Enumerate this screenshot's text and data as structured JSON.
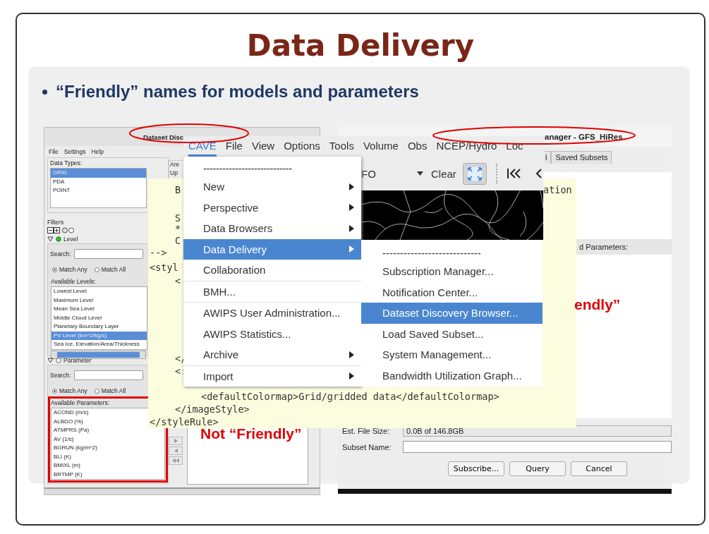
{
  "slide": {
    "title": "Data Delivery",
    "bullet": "“Friendly” names for models and parameters"
  },
  "discovery_window": {
    "title": "Dataset Disc",
    "menu": [
      "File",
      "Settings",
      "Help"
    ],
    "data_types_label": "Data Types:",
    "data_types": [
      {
        "label": "GRID",
        "selected": true
      },
      {
        "label": "PDA",
        "selected": false
      },
      {
        "label": "POINT",
        "selected": false
      }
    ],
    "area_label": "Are",
    "update_label": "Up",
    "filters_label": "Filters",
    "filters": [
      {
        "label": "Level",
        "expanded": true,
        "active": true,
        "search_label": "Search:",
        "match_options": [
          {
            "label": "Match Any",
            "selected": true
          },
          {
            "label": "Match All",
            "selected": false
          }
        ],
        "list_label": "Available Levels:",
        "highlighted": false,
        "items": [
          {
            "label": "Lowest Level",
            "selected": false
          },
          {
            "label": "Maximum Level",
            "selected": false
          },
          {
            "label": "Mean Sea Level",
            "selected": false
          },
          {
            "label": "Middle Cloud Level",
            "selected": false
          },
          {
            "label": "Planetary Boundary Layer",
            "selected": false
          },
          {
            "label": "PV Level (km^2/kg/s)",
            "selected": true
          },
          {
            "label": "Sea Ice, Elevation/Area/Thickness",
            "selected": false
          }
        ]
      },
      {
        "label": "Parameter",
        "expanded": true,
        "active": false,
        "search_label": "Search:",
        "match_options": [
          {
            "label": "Match Any",
            "selected": true
          },
          {
            "label": "Match All",
            "selected": false
          }
        ],
        "list_label": "Available Parameters:",
        "highlighted": true,
        "items": [
          {
            "label": "ACOND (m/s)",
            "selected": false
          },
          {
            "label": "ALBDO (%)",
            "selected": false
          },
          {
            "label": "ATMPRS (Pa)",
            "selected": false
          },
          {
            "label": "AV (1/s)",
            "selected": false
          },
          {
            "label": "BGRUN (kg/m^2)",
            "selected": false
          },
          {
            "label": "BLI (K)",
            "selected": false
          },
          {
            "label": "BMIXL (m)",
            "selected": false
          },
          {
            "label": "BRTMP (K)",
            "selected": false
          }
        ]
      }
    ]
  },
  "style_rule_code": {
    "lines": [
      {
        "text": "B"
      },
      {
        "text": "S"
      },
      {
        "text": "*"
      },
      {
        "text": "C"
      },
      {
        "text": "-->"
      },
      {
        "text": "<styl"
      },
      {
        "text": "<"
      },
      {
        "text": "</"
      },
      {
        "text": "<:"
      },
      {
        "text": "<defaultColormap>Grid/gridded data</defaultColormap>"
      },
      {
        "text": "</imageStyle>"
      },
      {
        "text": "</styleRule>"
      }
    ],
    "side_fragment": "ation"
  },
  "cave_window": {
    "menubar": [
      {
        "label": "CAVE",
        "selected": true
      },
      {
        "label": "File",
        "selected": false
      },
      {
        "label": "View",
        "selected": false
      },
      {
        "label": "Options",
        "selected": false
      },
      {
        "label": "Tools",
        "selected": false
      },
      {
        "label": "Volume",
        "selected": false
      },
      {
        "label": "Obs",
        "selected": false
      },
      {
        "label": "NCEP/Hydro",
        "selected": false
      },
      {
        "label": "Loc",
        "selected": false
      }
    ],
    "menu": [
      {
        "kind": "tearoff",
        "label": "----------------------------",
        "submenu": false,
        "selected": false,
        "divider_after": false
      },
      {
        "kind": "item",
        "label": "New",
        "submenu": true,
        "selected": false,
        "divider_after": false
      },
      {
        "kind": "item",
        "label": "Perspective",
        "submenu": true,
        "selected": false,
        "divider_after": false
      },
      {
        "kind": "item",
        "label": "Data Browsers",
        "submenu": true,
        "selected": false,
        "divider_after": false
      },
      {
        "kind": "item",
        "label": "Data Delivery",
        "submenu": true,
        "selected": true,
        "divider_after": false
      },
      {
        "kind": "item",
        "label": "Collaboration",
        "submenu": false,
        "selected": false,
        "divider_after": true
      },
      {
        "kind": "item",
        "label": "BMH...",
        "submenu": false,
        "selected": false,
        "divider_after": true
      },
      {
        "kind": "item",
        "label": "AWIPS User Administration...",
        "submenu": false,
        "selected": false,
        "divider_after": false
      },
      {
        "kind": "item",
        "label": "AWIPS Statistics...",
        "submenu": false,
        "selected": false,
        "divider_after": false
      },
      {
        "kind": "item",
        "label": "Archive",
        "submenu": true,
        "selected": false,
        "divider_after": true
      },
      {
        "kind": "item",
        "label": "Import",
        "submenu": true,
        "selected": false,
        "divider_after": false
      }
    ],
    "submenu": [
      {
        "kind": "tearoff",
        "label": "----------------------------",
        "selected": false
      },
      {
        "kind": "item",
        "label": "Subscription Manager...",
        "selected": false
      },
      {
        "kind": "item",
        "label": "Notification Center...",
        "selected": false
      },
      {
        "kind": "item",
        "label": "Dataset Discovery Browser...",
        "selected": true
      },
      {
        "kind": "item",
        "label": "Load Saved Subset...",
        "selected": false
      },
      {
        "kind": "item",
        "label": "System Management...",
        "selected": false
      },
      {
        "kind": "item",
        "label": "Bandwidth Utilization Graph...",
        "selected": false
      }
    ],
    "toolbar": {
      "field_fragment": "FO",
      "clear": "Clear"
    }
  },
  "subset_window": {
    "title": "anager - GFS_HiRes",
    "tabs": [
      {
        "label": "l",
        "selected": false
      },
      {
        "label": "Saved Subsets",
        "selected": false
      }
    ],
    "parameters_label": "d Parameters:",
    "file_size_label": "Est. File Size:",
    "file_size": "0.0B of 146.8GB",
    "subset_name_label": "Subset Name:",
    "buttons": [
      "Subscribe...",
      "Query",
      "Cancel"
    ]
  },
  "annotations": [
    {
      "kind": "parameters_note",
      "text": "Not “Friendly”"
    },
    {
      "kind": "subset_note",
      "text": "endly”"
    }
  ]
}
